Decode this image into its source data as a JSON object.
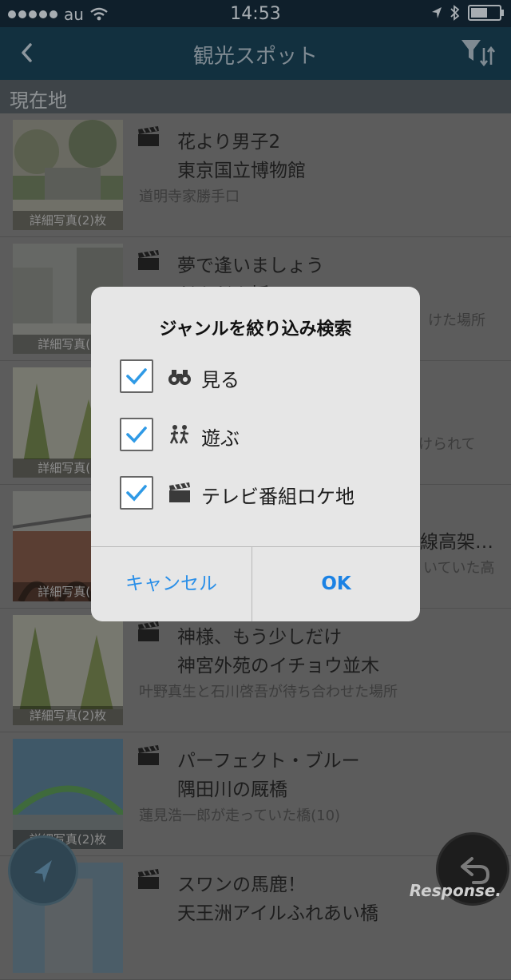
{
  "status_bar": {
    "carrier": "au",
    "time": "14:53"
  },
  "nav": {
    "title": "観光スポット"
  },
  "section": {
    "label": "現在地"
  },
  "rows": [
    {
      "line1": "花より男子2",
      "line2": "東京国立博物館",
      "line3": "道明寺家勝手口",
      "photos": "詳細写真(2)枚"
    },
    {
      "line1": "夢で逢いましょう",
      "line2": "だんだん坂",
      "line3": "けた場所",
      "photos": "詳細写真(1"
    },
    {
      "line1": "",
      "line2": "",
      "line3": "けられて",
      "photos": "詳細写真(1"
    },
    {
      "line1": "",
      "line2": "線高架…",
      "line3": "いていた高",
      "photos": "詳細写真(1"
    },
    {
      "line1": "神様、もう少しだけ",
      "line2": "神宮外苑のイチョウ並木",
      "line3": "叶野真生と石川啓吾が待ち合わせた場所",
      "photos": "詳細写真(2)枚"
    },
    {
      "line1": "パーフェクト・ブルー",
      "line2": "隅田川の厩橋",
      "line3": "蓮見浩一郎が走っていた橋(10)",
      "photos": "詳細写真(2)枚"
    },
    {
      "line1": "スワンの馬鹿！",
      "line2": "天王洲アイルふれあい橋",
      "line3": "",
      "photos": ""
    }
  ],
  "dialog": {
    "title": "ジャンルを絞り込み検索",
    "options": [
      {
        "label": "見る",
        "icon": "binoculars-icon",
        "checked": true
      },
      {
        "label": "遊ぶ",
        "icon": "people-running-icon",
        "checked": true
      },
      {
        "label": "テレビ番組ロケ地",
        "icon": "clapperboard-icon",
        "checked": true
      }
    ],
    "cancel_label": "キャンセル",
    "ok_label": "OK"
  },
  "watermark": "Response.",
  "colors": {
    "accent": "#1b82e4",
    "check": "#2f9ae6",
    "navbar": "#12303f"
  }
}
